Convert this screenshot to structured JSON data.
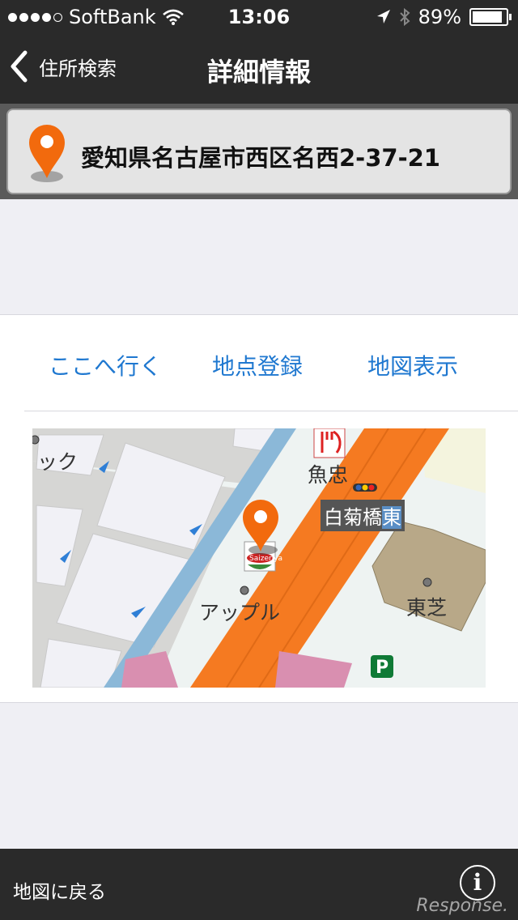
{
  "status_bar": {
    "carrier": "SoftBank",
    "time": "13:06",
    "battery": "89%",
    "battery_level": 0.89,
    "signal_bars": 4
  },
  "nav": {
    "back_label": "住所検索",
    "title": "詳細情報"
  },
  "address": {
    "text": "愛知県名古屋市西区名西2-37-21"
  },
  "actions": {
    "go_here": "ここへ行く",
    "register_point": "地点登録",
    "show_map": "地図表示"
  },
  "map": {
    "labels": {
      "top_left": "ック",
      "uochu": "魚忠",
      "shirakikubashi": "白菊橋",
      "higashi": "東",
      "apple": "アップル",
      "toshiba": "東芝",
      "parking": "P",
      "saizeriya": "Saizeriya"
    },
    "colors": {
      "main_road": "#f57a21",
      "river": "#8bb8d8",
      "building": "#d98fb0",
      "block": "#b8a888"
    }
  },
  "bottom_bar": {
    "back_to_map": "地図に戻る",
    "info": "i"
  },
  "watermark": "Response."
}
